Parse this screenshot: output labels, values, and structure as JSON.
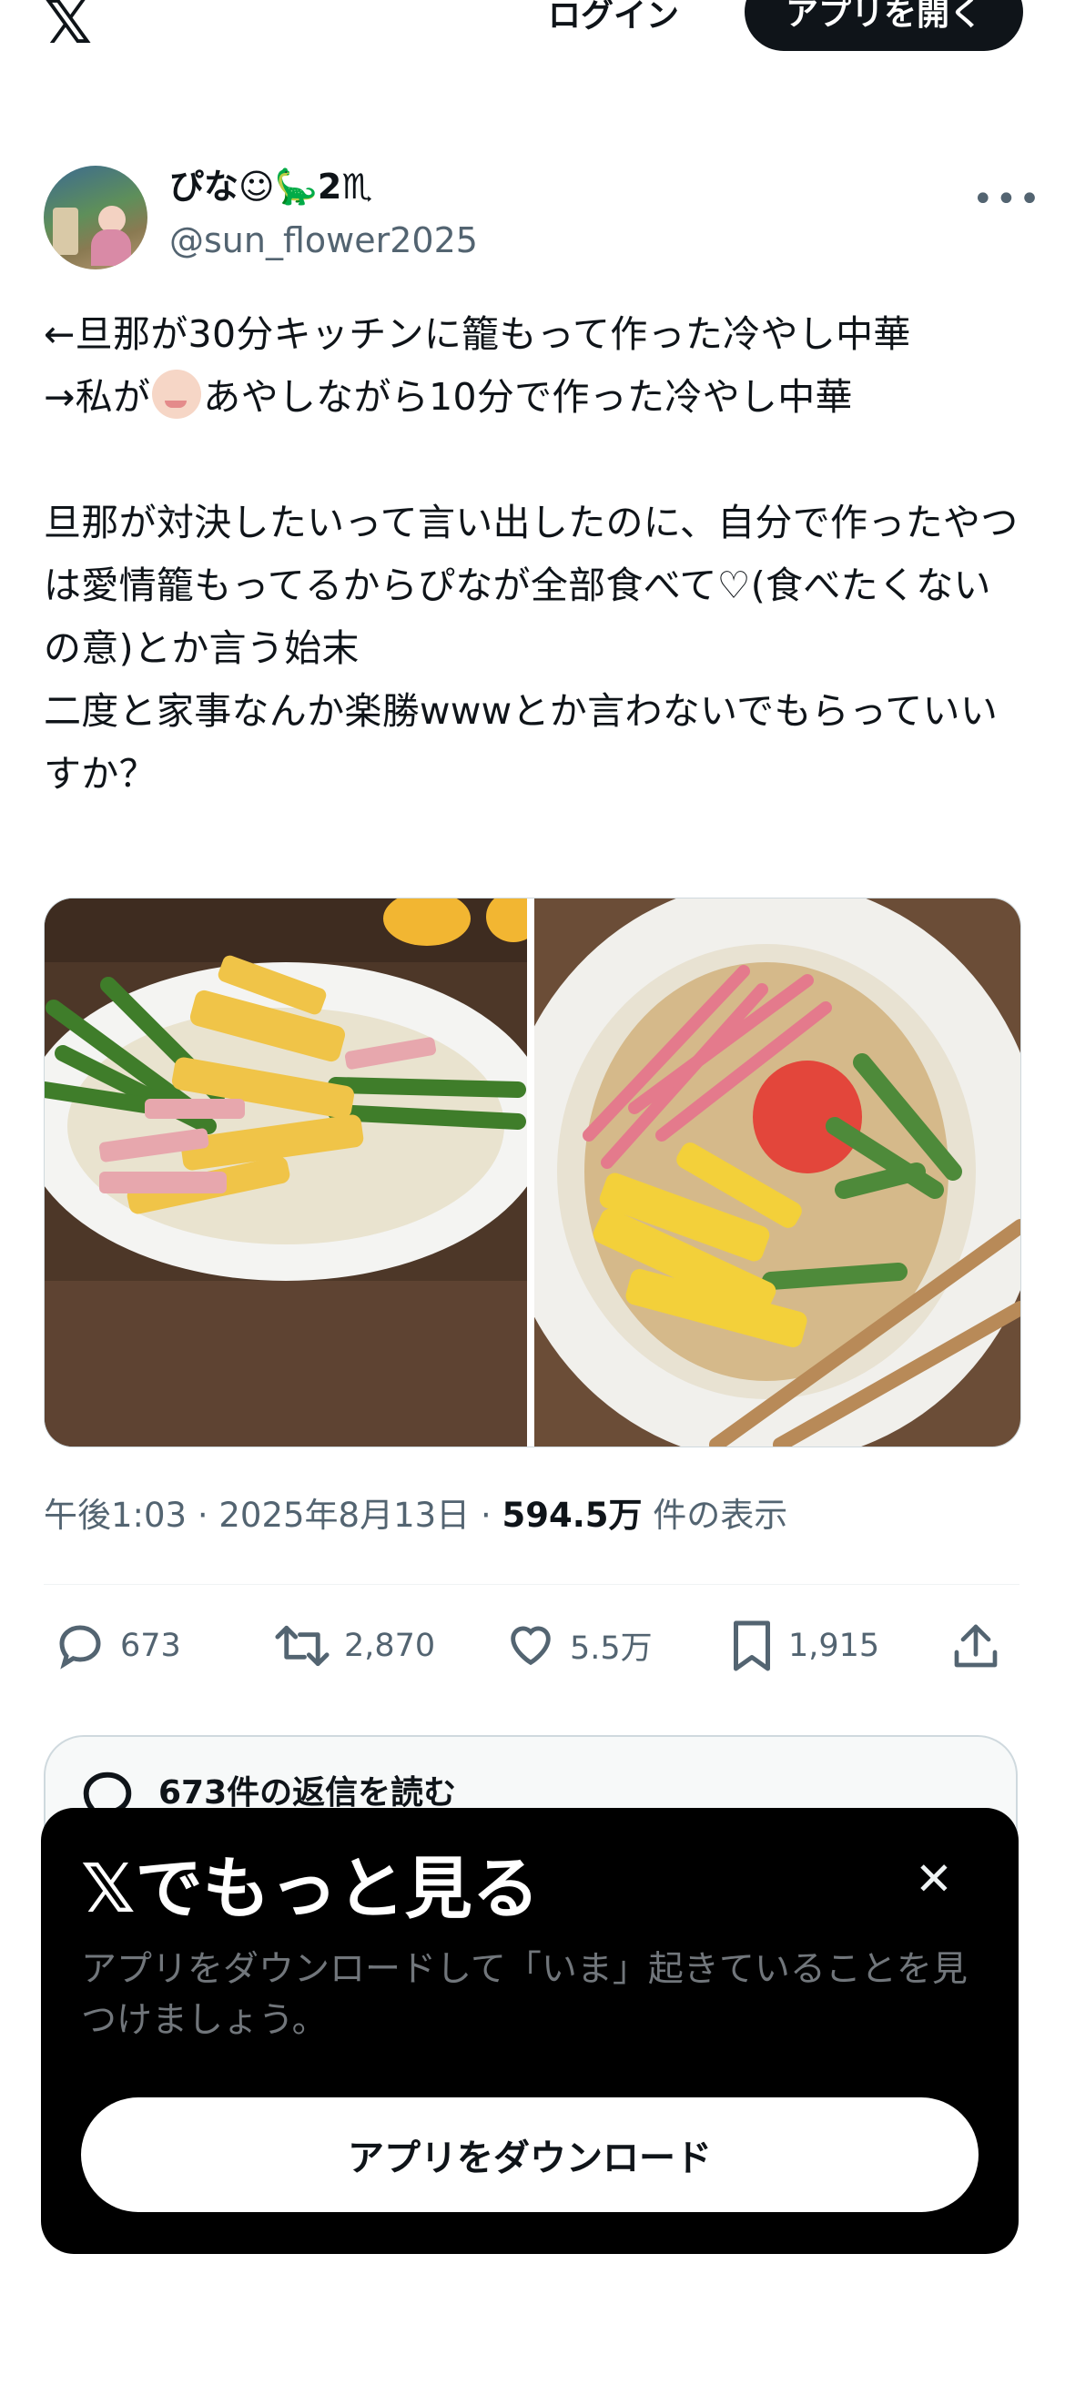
{
  "topbar": {
    "logo": "𝕏",
    "login": "ログイン",
    "open_app": "アプリを開く"
  },
  "user": {
    "display_name": "ぴな☺🦕2♏",
    "handle": "@sun_flower2025"
  },
  "tweet": {
    "line1": "←旦那が30分キッチンに籠もって作った冷やし中華",
    "line2a": "→私が",
    "line2b": "あやしながら10分で作った冷やし中華",
    "para2": "旦那が対決したいって言い出したのに、自分で作ったやつは愛情籠もってるからぴなが全部食べて♡(食べたくないの意)とか言う始末\n二度と家事なんか楽勝wwwとか言わないでもらっていいすか？"
  },
  "meta": {
    "time": "午後1:03",
    "date": "2025年8月13日",
    "views": "594.5万",
    "views_label": "件の表示",
    "sep": "·"
  },
  "actions": {
    "replies": "673",
    "reposts": "2,870",
    "likes": "5.5万",
    "bookmarks": "1,915"
  },
  "read_replies": "673件の返信を読む",
  "sheet": {
    "title": "𝕏でもっと見る",
    "subtitle": "アプリをダウンロードして「いま」起きていることを見つけましょう。",
    "button": "アプリをダウンロード",
    "close": "✕"
  }
}
